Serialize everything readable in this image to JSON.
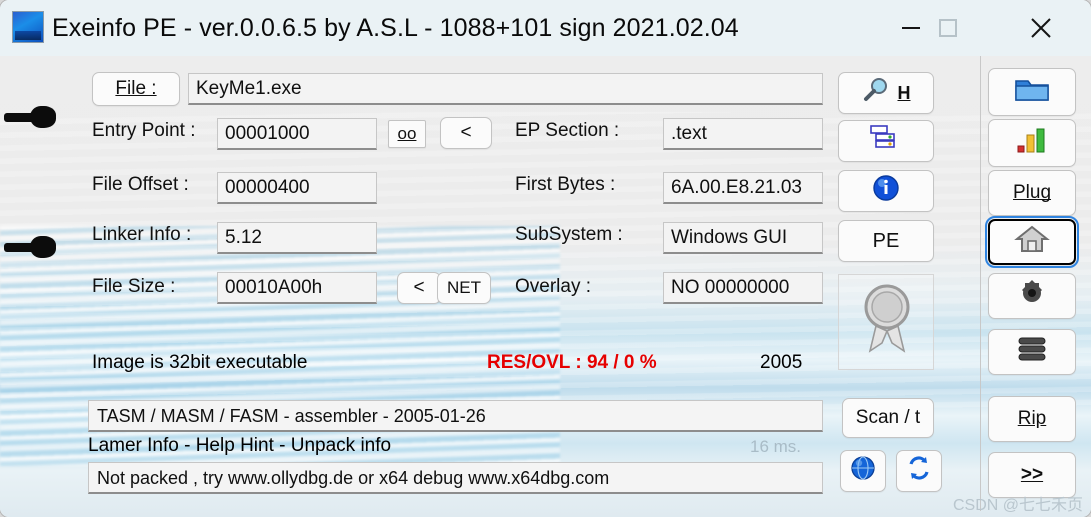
{
  "window": {
    "title": "Exeinfo PE - ver.0.0.6.5  by A.S.L -  1088+101 sign  2021.02.04",
    "app_icon": "exeinfo-app-icon",
    "controls": {
      "minimize": "minimize-icon",
      "maximize": "maximize-icon",
      "close": "close-icon"
    }
  },
  "form": {
    "file_button": "File :",
    "file_value": "KeyMe1.exe",
    "entry_point_label": "Entry Point :",
    "entry_point_value": "00001000",
    "oo_button": "oo",
    "ep_back_button": "<",
    "ep_section_label": "EP Section :",
    "ep_section_value": ".text",
    "file_offset_label": "File Offset :",
    "file_offset_value": "00000400",
    "first_bytes_label": "First Bytes :",
    "first_bytes_value": "6A.00.E8.21.03",
    "linker_info_label": "Linker Info :",
    "linker_info_value": "5.12",
    "subsystem_label": "SubSystem :",
    "subsystem_value": "Windows GUI",
    "file_size_label": "File Size :",
    "file_size_value": "00010A00h",
    "size_back_button": "<",
    "net_button": "NET",
    "overlay_label": "Overlay :",
    "overlay_value": "NO  00000000"
  },
  "status": {
    "image_type": "Image is 32bit executable",
    "res_ovl": "RES/OVL : 94 / 0 %",
    "res_ovl_color": "#e60000",
    "year": "2005",
    "scan_result": "TASM / MASM / FASM - assembler - 2005-01-26",
    "hint_line": "Lamer Info - Help Hint - Unpack info",
    "elapsed": "16 ms.",
    "unpack_info": "Not packed , try  www.ollydbg.de or x64 debug www.x64dbg.com"
  },
  "middle_buttons": [
    {
      "name": "search-hex-button",
      "label": "H",
      "icon": "magnifier-icon"
    },
    {
      "name": "sections-button",
      "label": "",
      "icon": "sections-list-icon"
    },
    {
      "name": "info-button",
      "label": "",
      "icon": "info-circle-icon"
    },
    {
      "name": "pe-button",
      "label": "PE",
      "icon": ""
    }
  ],
  "medal": {
    "icon": "medal-ribbon-icon"
  },
  "scan_button": {
    "label": "Scan / t"
  },
  "small_buttons": [
    {
      "name": "globe-button",
      "icon": "globe-icon"
    },
    {
      "name": "refresh-button",
      "icon": "refresh-arrows-icon"
    }
  ],
  "sidebar": [
    {
      "name": "open-file-button",
      "label": "",
      "icon": "folder-icon",
      "focused": false
    },
    {
      "name": "entropy-button",
      "label": "",
      "icon": "bar-chart-icon",
      "focused": false
    },
    {
      "name": "plugins-button",
      "label": "Plug",
      "icon": "",
      "focused": false
    },
    {
      "name": "home-button",
      "label": "",
      "icon": "house-icon",
      "focused": true
    },
    {
      "name": "options-button",
      "label": "",
      "icon": "gear-icon",
      "focused": false
    },
    {
      "name": "stack-button",
      "label": "",
      "icon": "stack-layers-icon",
      "focused": false
    },
    {
      "name": "rip-button",
      "label": "Rip",
      "icon": "",
      "focused": false
    },
    {
      "name": "more-button",
      "label": ">>",
      "icon": "",
      "focused": false
    }
  ],
  "watermark": "CSDN @七七禾页"
}
